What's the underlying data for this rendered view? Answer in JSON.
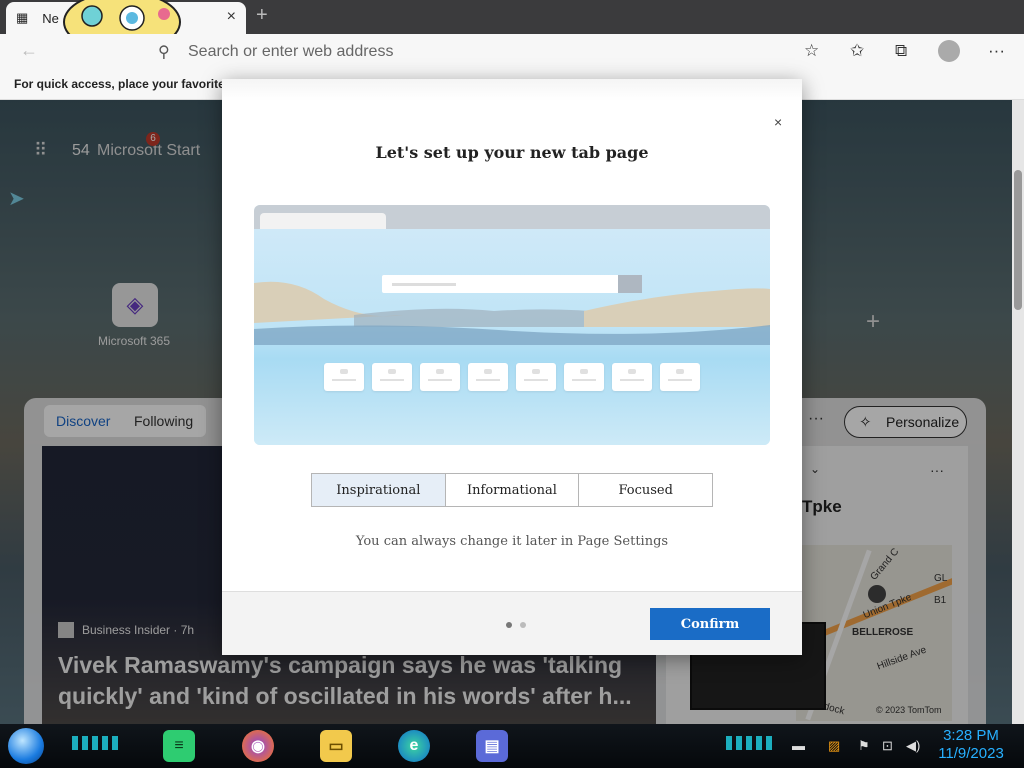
{
  "browser": {
    "tab_title": "Ne",
    "tab_close": "×",
    "new_tab": "+",
    "address_placeholder": "Search or enter web address",
    "favorites_bar_text": "For quick access, place your favorites h",
    "more_label": "···"
  },
  "newtab_page": {
    "weather": "54",
    "brand": "Microsoft Start",
    "notification_count": "6",
    "quick_link": "Microsoft 365",
    "feed_tabs": [
      "Discover",
      "Following"
    ],
    "personalize_label": "Personalize",
    "more_dots": "···",
    "article": {
      "source": "Business Insider · 7h",
      "headline": "Vivek Ramaswamy's campaign says he was 'talking quickly' and 'kind of oscillated in his words' after h..."
    },
    "side_card": {
      "title": "Tpke",
      "map_labels": [
        "Grand C",
        "Union Tpke",
        "BELLEROSE",
        "Hillside Ave",
        "GL",
        "B1",
        "ddock",
        "© 2023 TomTom"
      ]
    }
  },
  "modal": {
    "title": "Let's set up your new tab page",
    "close": "×",
    "options": [
      "Inspirational",
      "Informational",
      "Focused"
    ],
    "selected_option": "Inspirational",
    "hint": "You can always change it later in Page Settings",
    "confirm_label": "Confirm",
    "page_count": 2,
    "current_page": 1
  },
  "taskbar": {
    "time": "3:28 PM",
    "date": "11/9/2023"
  },
  "colors": {
    "accent": "#1a6cc6",
    "clock": "#27b0ff",
    "discover_tab": "#1a66c8"
  }
}
